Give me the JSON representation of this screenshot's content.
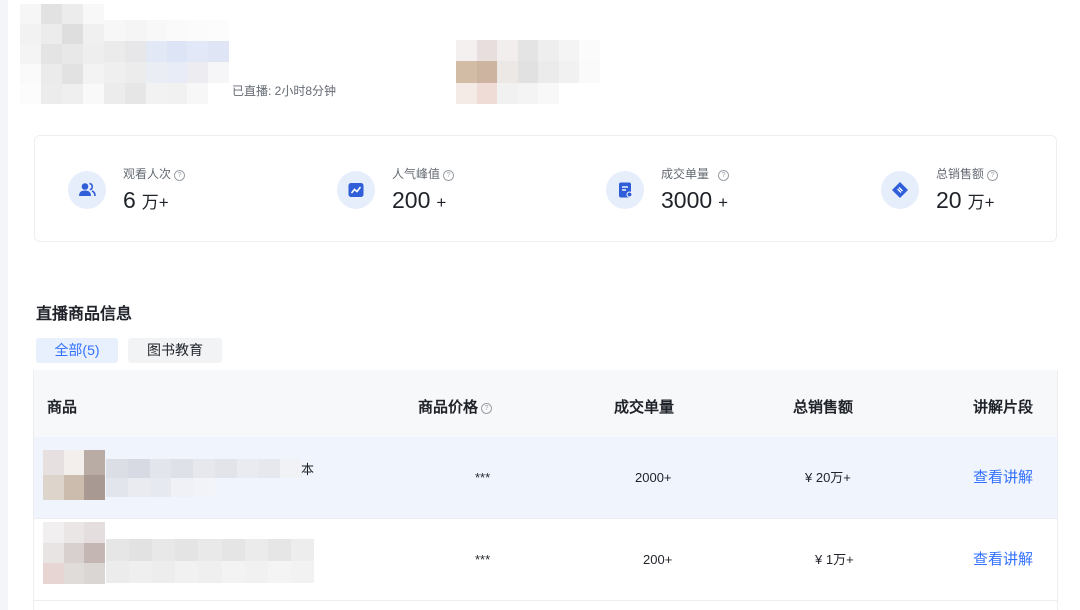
{
  "header": {
    "live_duration": "已直播: 2小时8分钟"
  },
  "stats": [
    {
      "label": "观看人次",
      "value": "6",
      "unit": "万+",
      "icon": "users-icon"
    },
    {
      "label": "人气峰值",
      "value": "200",
      "unit": "+",
      "icon": "trend-chart-icon"
    },
    {
      "label": "成交单量",
      "value": "3000",
      "unit": "+",
      "icon": "order-doc-icon"
    },
    {
      "label": "总销售额",
      "value": "20",
      "unit": "万+",
      "icon": "sales-tag-icon"
    }
  ],
  "section": {
    "title": "直播商品信息",
    "tabs": [
      {
        "label": "全部(5)",
        "active": true
      },
      {
        "label": "图书教育",
        "active": false
      }
    ]
  },
  "table": {
    "columns": [
      "商品",
      "商品价格",
      "成交单量",
      "总销售额",
      "讲解片段"
    ],
    "rows": [
      {
        "name_tail": "本",
        "price": "***",
        "orders": "2000+",
        "sales": "¥ 20万+",
        "action": "查看讲解"
      },
      {
        "name_tail": "",
        "price": "***",
        "orders": "200+",
        "sales": "¥ 1万+",
        "action": "查看讲解"
      }
    ]
  },
  "colors": {
    "accent": "#3370ff",
    "icon_bg": "#e6edfb",
    "icon_fg": "#2f5ed8",
    "table_header_bg": "#f7f8fa",
    "row_highlight_bg": "#f0f4fc"
  }
}
